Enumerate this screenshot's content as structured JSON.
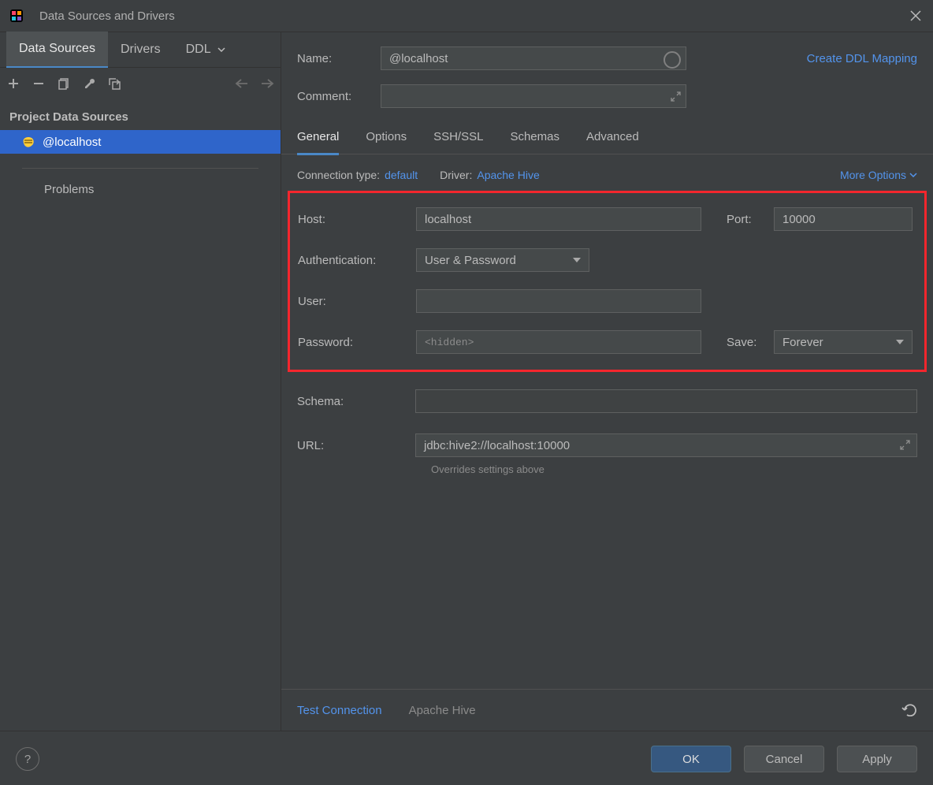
{
  "window": {
    "title": "Data Sources and Drivers"
  },
  "sidebar": {
    "tabs": [
      {
        "label": "Data Sources",
        "active": true
      },
      {
        "label": "Drivers",
        "active": false
      },
      {
        "label": "DDL",
        "active": false
      }
    ],
    "section_title": "Project Data Sources",
    "datasource": "@localhost",
    "problems": "Problems"
  },
  "header": {
    "name_label": "Name:",
    "name_value": "@localhost",
    "comment_label": "Comment:",
    "ddl_link": "Create DDL Mapping"
  },
  "sub_tabs": [
    {
      "label": "General",
      "active": true
    },
    {
      "label": "Options"
    },
    {
      "label": "SSH/SSL"
    },
    {
      "label": "Schemas"
    },
    {
      "label": "Advanced"
    }
  ],
  "conn": {
    "type_label": "Connection type:",
    "type_value": "default",
    "driver_label": "Driver:",
    "driver_value": "Apache Hive",
    "more": "More Options"
  },
  "fields": {
    "host_label": "Host:",
    "host_value": "localhost",
    "port_label": "Port:",
    "port_value": "10000",
    "auth_label": "Authentication:",
    "auth_value": "User & Password",
    "user_label": "User:",
    "user_value": "",
    "pass_label": "Password:",
    "pass_placeholder": "<hidden>",
    "save_label": "Save:",
    "save_value": "Forever",
    "schema_label": "Schema:",
    "schema_value": "",
    "url_label": "URL:",
    "url_value": "jdbc:hive2://localhost:10000",
    "url_note": "Overrides settings above"
  },
  "footer": {
    "test": "Test Connection",
    "driver": "Apache Hive"
  },
  "buttons": {
    "ok": "OK",
    "cancel": "Cancel",
    "apply": "Apply"
  }
}
